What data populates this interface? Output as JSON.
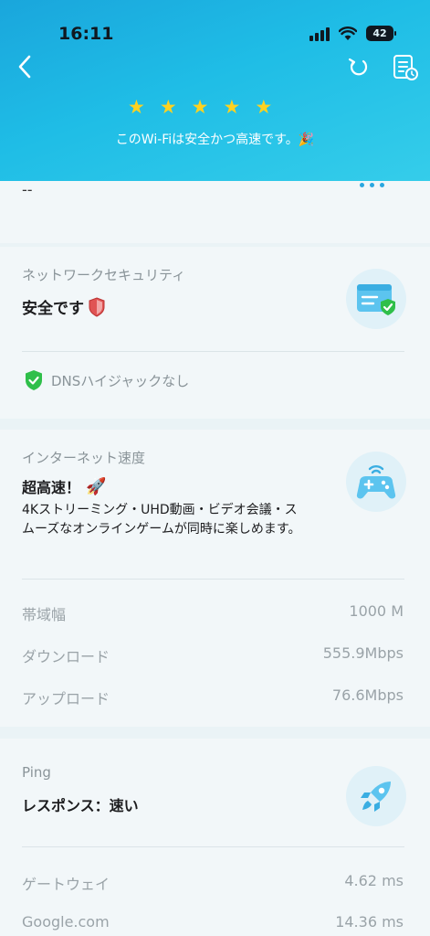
{
  "status_bar": {
    "time": "16:11",
    "battery": "42"
  },
  "header": {
    "title": "",
    "rating": 5,
    "message": "このWi-Fiは安全かつ高速です。🎉"
  },
  "cutoff": {
    "value": "--"
  },
  "security": {
    "label": "ネットワークセキュリティ",
    "status": "安全です",
    "dns": "DNSハイジャックなし"
  },
  "internet": {
    "label": "インターネット速度",
    "status": "超高速！",
    "description": "4Kストリーミング・UHD動画・ビデオ会議・スムーズなオンラインゲームが同時に楽しめます。",
    "rows": [
      {
        "key": "帯域幅",
        "value": "1000 M"
      },
      {
        "key": "ダウンロード",
        "value": "555.9Mbps"
      },
      {
        "key": "アップロード",
        "value": "76.6Mbps"
      }
    ]
  },
  "ping": {
    "label": "Ping",
    "status": "レスポンス：速い",
    "rows": [
      {
        "key": "ゲートウェイ",
        "value": "4.62 ms"
      },
      {
        "key": "Google.com",
        "value": "14.36 ms"
      }
    ]
  },
  "colors": {
    "accent": "#2aa7e0",
    "star": "#ffd21f",
    "shield_green": "#2fbf4a"
  },
  "icons": [
    "back-icon",
    "refresh-icon",
    "report-icon",
    "star-icon",
    "shield-icon",
    "gamepad-icon",
    "rocket-icon",
    "check-shield-icon"
  ]
}
